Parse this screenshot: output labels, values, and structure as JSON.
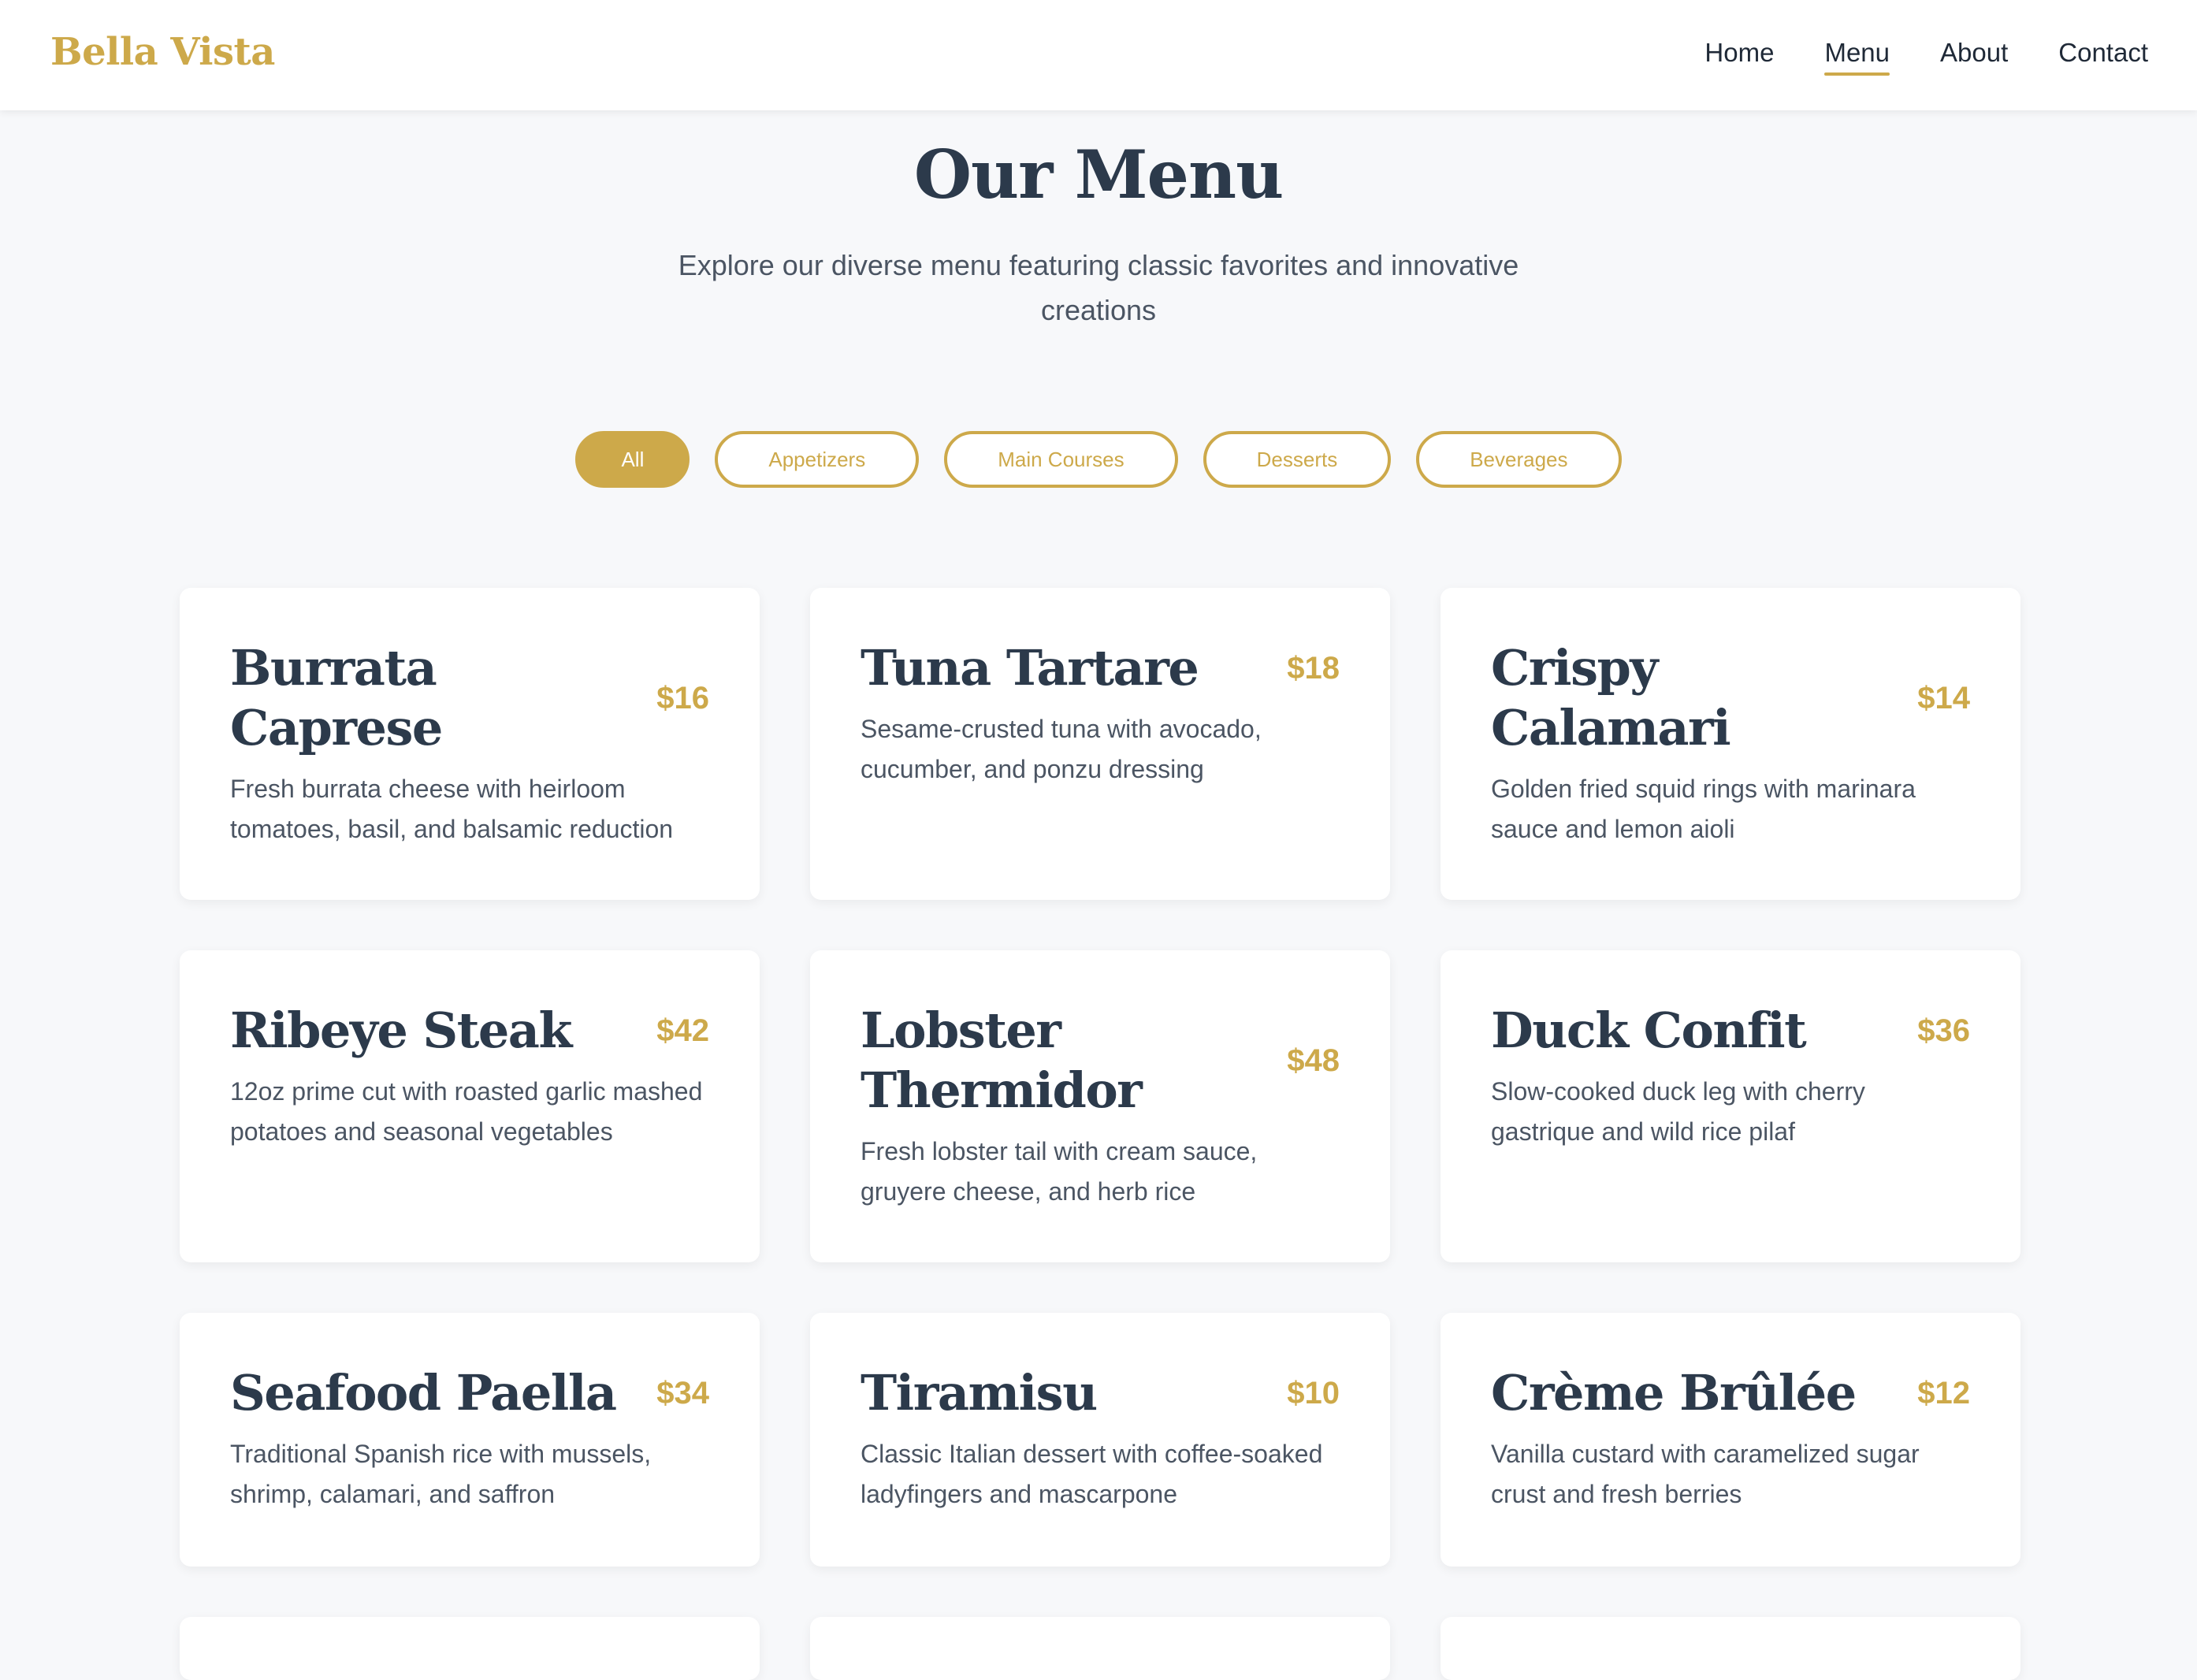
{
  "header": {
    "logo": "Bella Vista",
    "nav": [
      {
        "label": "Home",
        "active": false
      },
      {
        "label": "Menu",
        "active": true
      },
      {
        "label": "About",
        "active": false
      },
      {
        "label": "Contact",
        "active": false
      }
    ]
  },
  "hero": {
    "title": "Our Menu",
    "subtitle": "Explore our diverse menu featuring classic favorites and innovative creations"
  },
  "filters": [
    {
      "label": "All",
      "active": true
    },
    {
      "label": "Appetizers",
      "active": false
    },
    {
      "label": "Main Courses",
      "active": false
    },
    {
      "label": "Desserts",
      "active": false
    },
    {
      "label": "Beverages",
      "active": false
    }
  ],
  "menu_items": [
    {
      "name": "Burrata Caprese",
      "price": "$16",
      "description": "Fresh burrata cheese with heirloom tomatoes, basil, and balsamic reduction"
    },
    {
      "name": "Tuna Tartare",
      "price": "$18",
      "description": "Sesame-crusted tuna with avocado, cucumber, and ponzu dressing"
    },
    {
      "name": "Crispy Calamari",
      "price": "$14",
      "description": "Golden fried squid rings with marinara sauce and lemon aioli"
    },
    {
      "name": "Ribeye Steak",
      "price": "$42",
      "description": "12oz prime cut with roasted garlic mashed potatoes and seasonal vegetables"
    },
    {
      "name": "Lobster Thermidor",
      "price": "$48",
      "description": "Fresh lobster tail with cream sauce, gruyere cheese, and herb rice"
    },
    {
      "name": "Duck Confit",
      "price": "$36",
      "description": "Slow-cooked duck leg with cherry gastrique and wild rice pilaf"
    },
    {
      "name": "Seafood Paella",
      "price": "$34",
      "description": "Traditional Spanish rice with mussels, shrimp, calamari, and saffron"
    },
    {
      "name": "Tiramisu",
      "price": "$10",
      "description": "Classic Italian dessert with coffee-soaked ladyfingers and mascarpone"
    },
    {
      "name": "Crème Brûlée",
      "price": "$12",
      "description": "Vanilla custard with caramelized sugar crust and fresh berries"
    }
  ],
  "theme": {
    "accent": "#cda94a",
    "heading": "#2c3a4b",
    "background": "#f7f8fa"
  }
}
